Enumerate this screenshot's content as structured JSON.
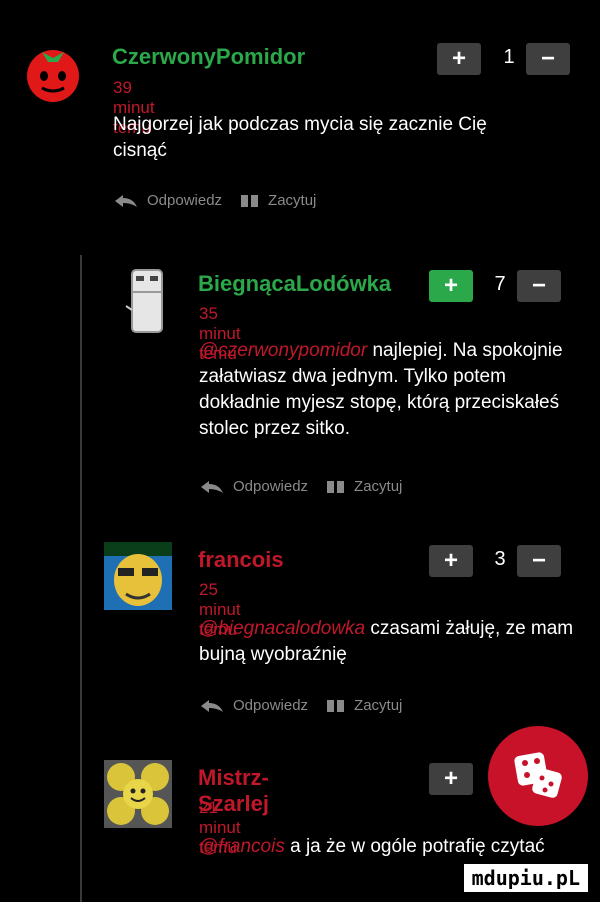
{
  "comments": [
    {
      "username": "CzerwonyPomidor",
      "time": "39 minut temu",
      "mention": "",
      "text": "Najgorzej jak podczas mycia się zacznie Cię cisnąć",
      "score": "1",
      "username_color": "#2aa84a",
      "avatar": "tomato-icon"
    },
    {
      "username": "BiegnącaLodówka",
      "time": "35 minut temu",
      "mention": "@czerwonypomidor",
      "text": "najlepiej. Na spokojnie załatwiasz dwa jednym. Tylko potem dokładnie myjesz stopę, którą przeciskałeś stolec przez sitko.",
      "score": "7",
      "username_color": "#2aa84a",
      "avatar": "fridge-icon"
    },
    {
      "username": "francois",
      "time": "25 minut temu",
      "mention": "@biegnacalodowka",
      "text": "czasami żałuję, ze mam bujną wyobraźnię",
      "score": "3",
      "username_color": "#c0182a",
      "avatar": "face-avatar"
    },
    {
      "username": "Mistrz-Szarlej",
      "time": "21 minut temu",
      "mention": "@francois",
      "text": "a ja że w ogóle potrafię czytać",
      "score": "",
      "username_color": "#c0182a",
      "avatar": "smiley-grid-avatar"
    }
  ],
  "actions": {
    "reply": "Odpowiedz",
    "quote": "Zacytuj"
  },
  "vote": {
    "plus": "+",
    "minus": "−"
  },
  "brand": "mdupiu.pL",
  "colors": {
    "accent_green": "#2aa84a",
    "accent_red": "#c0182a",
    "button_bg": "#3f3f3f"
  }
}
